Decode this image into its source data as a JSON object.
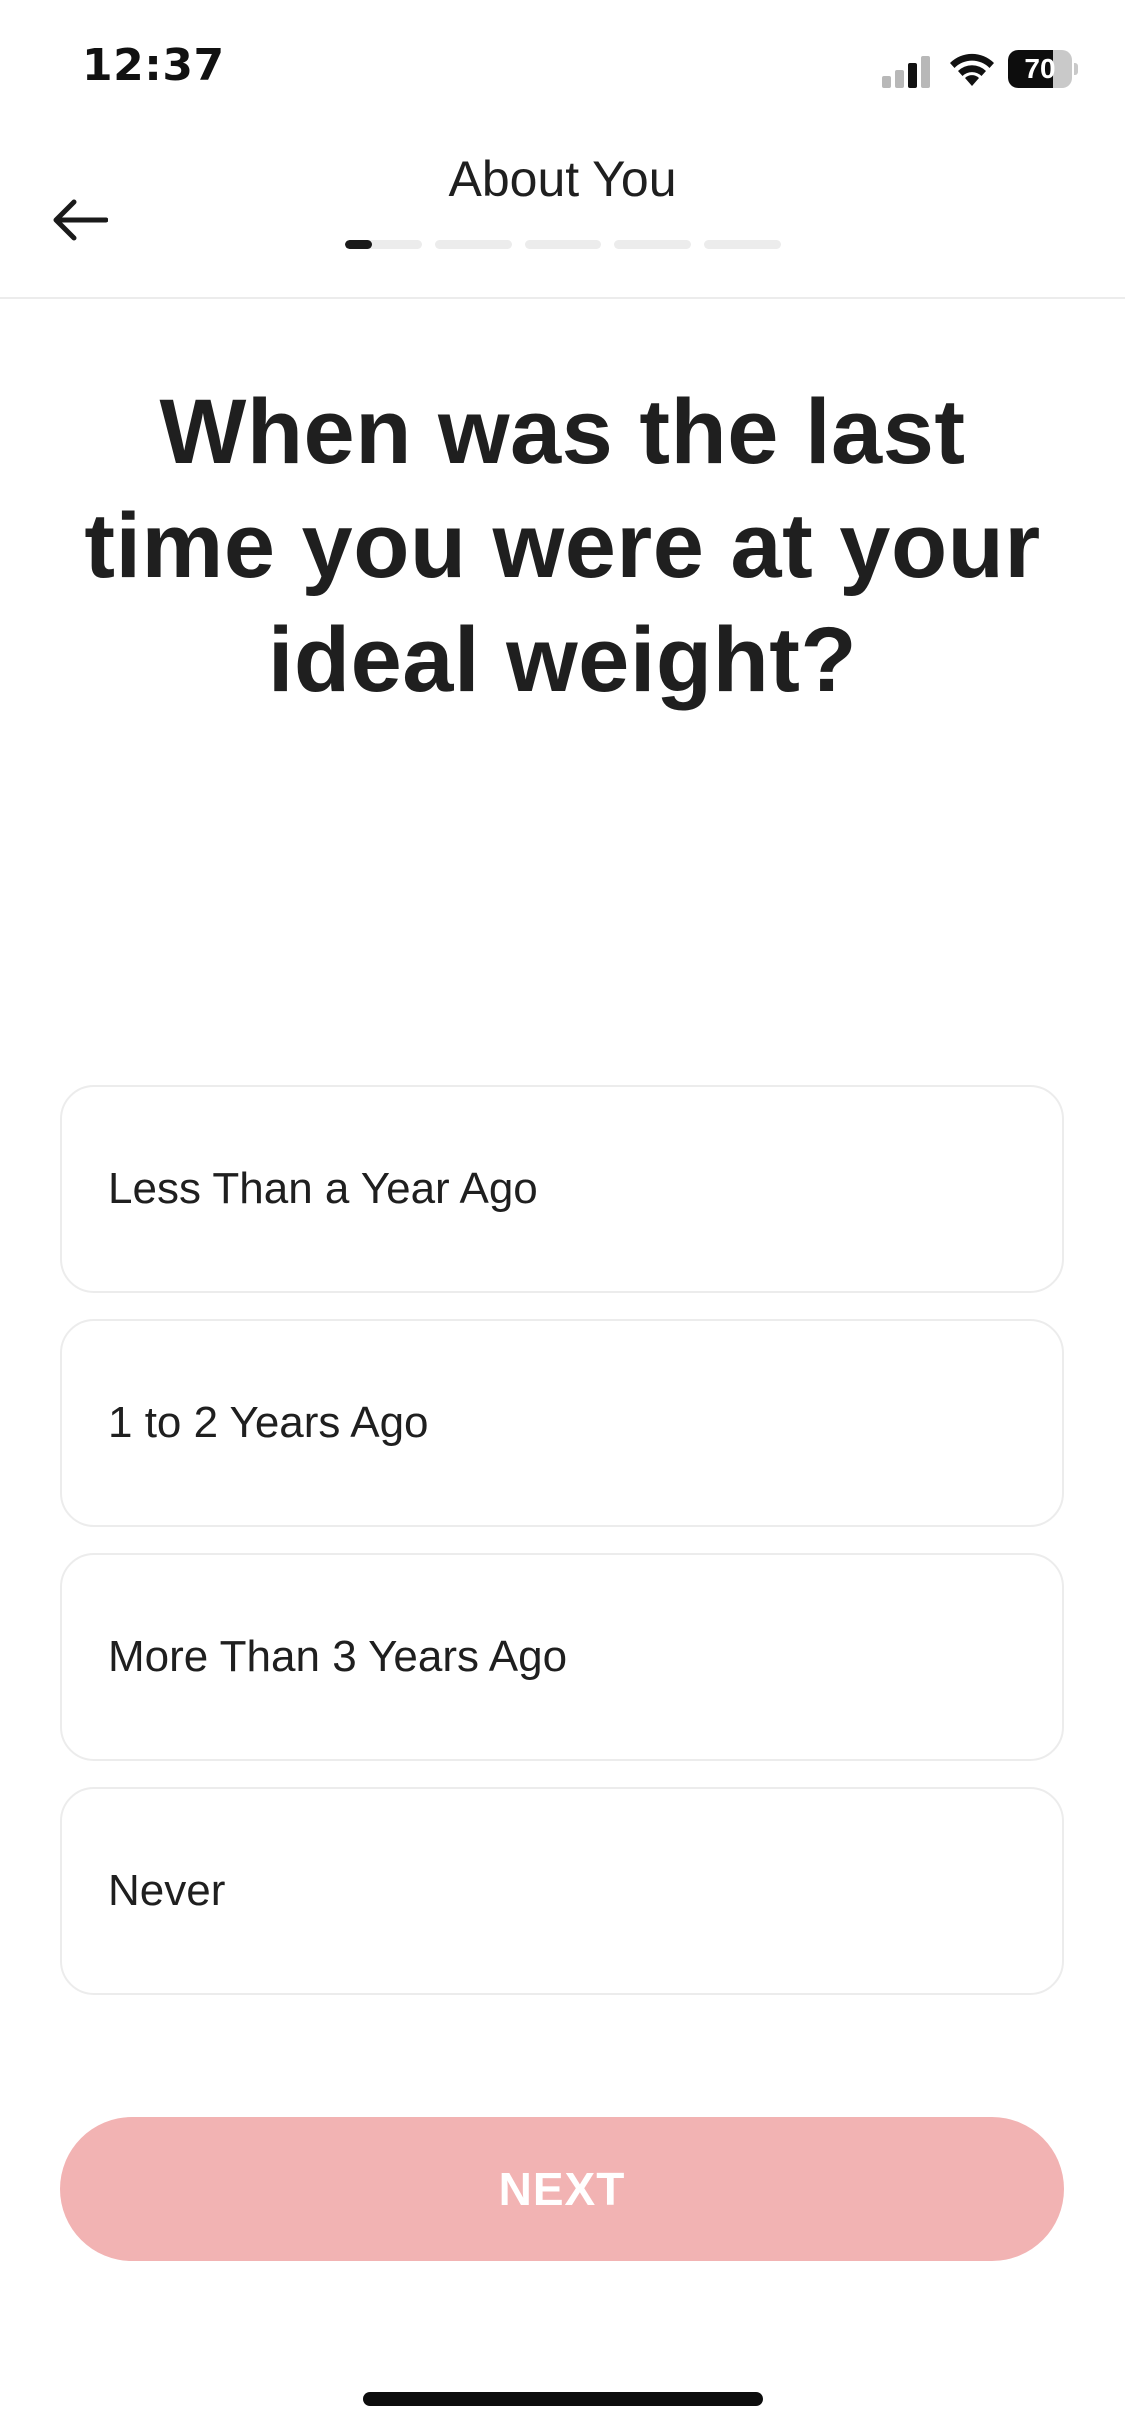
{
  "status_bar": {
    "time": "12:37",
    "battery_level": "70",
    "battery_fraction": 0.7,
    "signal_icon": "cellular-signal-icon",
    "wifi_icon": "wifi-icon"
  },
  "header": {
    "title": "About You",
    "back_icon": "arrow-left-icon",
    "progress": {
      "total_steps": 5,
      "current_step_fraction": 0.2
    }
  },
  "question": "When was the last time you were at your ideal weight?",
  "options": [
    {
      "label": "Less Than a Year Ago"
    },
    {
      "label": "1 to 2 Years Ago"
    },
    {
      "label": "More Than 3 Years Ago"
    },
    {
      "label": "Never"
    }
  ],
  "next_button": {
    "label": "NEXT",
    "disabled": true
  },
  "colors": {
    "accent_disabled": "#f2b3b3",
    "text": "#1f1f1f",
    "border": "#ececec",
    "progress_active": "#1a1a1a",
    "progress_inactive": "#ececec"
  }
}
